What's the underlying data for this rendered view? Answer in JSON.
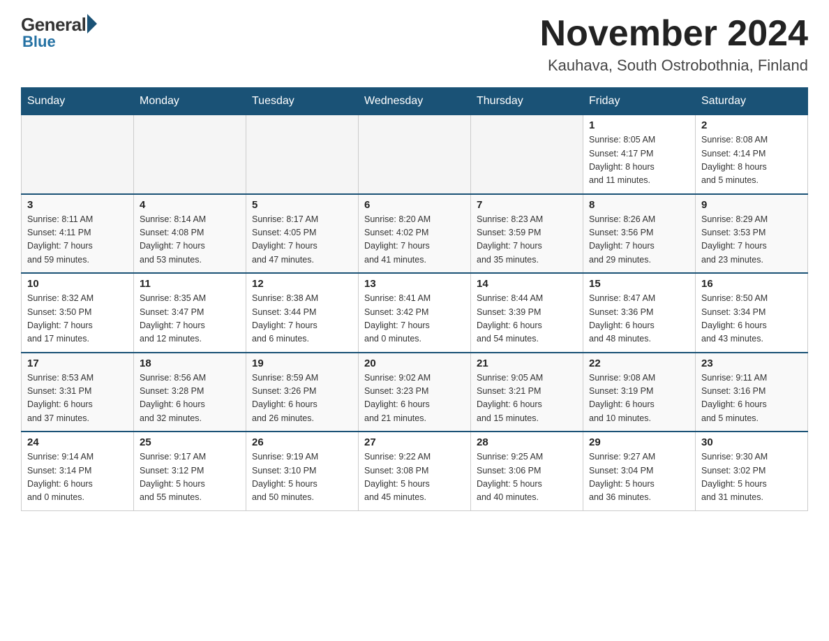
{
  "logo": {
    "general": "General",
    "blue": "Blue"
  },
  "header": {
    "month": "November 2024",
    "location": "Kauhava, South Ostrobothnia, Finland"
  },
  "weekdays": [
    "Sunday",
    "Monday",
    "Tuesday",
    "Wednesday",
    "Thursday",
    "Friday",
    "Saturday"
  ],
  "weeks": [
    [
      {
        "day": "",
        "info": ""
      },
      {
        "day": "",
        "info": ""
      },
      {
        "day": "",
        "info": ""
      },
      {
        "day": "",
        "info": ""
      },
      {
        "day": "",
        "info": ""
      },
      {
        "day": "1",
        "info": "Sunrise: 8:05 AM\nSunset: 4:17 PM\nDaylight: 8 hours\nand 11 minutes."
      },
      {
        "day": "2",
        "info": "Sunrise: 8:08 AM\nSunset: 4:14 PM\nDaylight: 8 hours\nand 5 minutes."
      }
    ],
    [
      {
        "day": "3",
        "info": "Sunrise: 8:11 AM\nSunset: 4:11 PM\nDaylight: 7 hours\nand 59 minutes."
      },
      {
        "day": "4",
        "info": "Sunrise: 8:14 AM\nSunset: 4:08 PM\nDaylight: 7 hours\nand 53 minutes."
      },
      {
        "day": "5",
        "info": "Sunrise: 8:17 AM\nSunset: 4:05 PM\nDaylight: 7 hours\nand 47 minutes."
      },
      {
        "day": "6",
        "info": "Sunrise: 8:20 AM\nSunset: 4:02 PM\nDaylight: 7 hours\nand 41 minutes."
      },
      {
        "day": "7",
        "info": "Sunrise: 8:23 AM\nSunset: 3:59 PM\nDaylight: 7 hours\nand 35 minutes."
      },
      {
        "day": "8",
        "info": "Sunrise: 8:26 AM\nSunset: 3:56 PM\nDaylight: 7 hours\nand 29 minutes."
      },
      {
        "day": "9",
        "info": "Sunrise: 8:29 AM\nSunset: 3:53 PM\nDaylight: 7 hours\nand 23 minutes."
      }
    ],
    [
      {
        "day": "10",
        "info": "Sunrise: 8:32 AM\nSunset: 3:50 PM\nDaylight: 7 hours\nand 17 minutes."
      },
      {
        "day": "11",
        "info": "Sunrise: 8:35 AM\nSunset: 3:47 PM\nDaylight: 7 hours\nand 12 minutes."
      },
      {
        "day": "12",
        "info": "Sunrise: 8:38 AM\nSunset: 3:44 PM\nDaylight: 7 hours\nand 6 minutes."
      },
      {
        "day": "13",
        "info": "Sunrise: 8:41 AM\nSunset: 3:42 PM\nDaylight: 7 hours\nand 0 minutes."
      },
      {
        "day": "14",
        "info": "Sunrise: 8:44 AM\nSunset: 3:39 PM\nDaylight: 6 hours\nand 54 minutes."
      },
      {
        "day": "15",
        "info": "Sunrise: 8:47 AM\nSunset: 3:36 PM\nDaylight: 6 hours\nand 48 minutes."
      },
      {
        "day": "16",
        "info": "Sunrise: 8:50 AM\nSunset: 3:34 PM\nDaylight: 6 hours\nand 43 minutes."
      }
    ],
    [
      {
        "day": "17",
        "info": "Sunrise: 8:53 AM\nSunset: 3:31 PM\nDaylight: 6 hours\nand 37 minutes."
      },
      {
        "day": "18",
        "info": "Sunrise: 8:56 AM\nSunset: 3:28 PM\nDaylight: 6 hours\nand 32 minutes."
      },
      {
        "day": "19",
        "info": "Sunrise: 8:59 AM\nSunset: 3:26 PM\nDaylight: 6 hours\nand 26 minutes."
      },
      {
        "day": "20",
        "info": "Sunrise: 9:02 AM\nSunset: 3:23 PM\nDaylight: 6 hours\nand 21 minutes."
      },
      {
        "day": "21",
        "info": "Sunrise: 9:05 AM\nSunset: 3:21 PM\nDaylight: 6 hours\nand 15 minutes."
      },
      {
        "day": "22",
        "info": "Sunrise: 9:08 AM\nSunset: 3:19 PM\nDaylight: 6 hours\nand 10 minutes."
      },
      {
        "day": "23",
        "info": "Sunrise: 9:11 AM\nSunset: 3:16 PM\nDaylight: 6 hours\nand 5 minutes."
      }
    ],
    [
      {
        "day": "24",
        "info": "Sunrise: 9:14 AM\nSunset: 3:14 PM\nDaylight: 6 hours\nand 0 minutes."
      },
      {
        "day": "25",
        "info": "Sunrise: 9:17 AM\nSunset: 3:12 PM\nDaylight: 5 hours\nand 55 minutes."
      },
      {
        "day": "26",
        "info": "Sunrise: 9:19 AM\nSunset: 3:10 PM\nDaylight: 5 hours\nand 50 minutes."
      },
      {
        "day": "27",
        "info": "Sunrise: 9:22 AM\nSunset: 3:08 PM\nDaylight: 5 hours\nand 45 minutes."
      },
      {
        "day": "28",
        "info": "Sunrise: 9:25 AM\nSunset: 3:06 PM\nDaylight: 5 hours\nand 40 minutes."
      },
      {
        "day": "29",
        "info": "Sunrise: 9:27 AM\nSunset: 3:04 PM\nDaylight: 5 hours\nand 36 minutes."
      },
      {
        "day": "30",
        "info": "Sunrise: 9:30 AM\nSunset: 3:02 PM\nDaylight: 5 hours\nand 31 minutes."
      }
    ]
  ]
}
